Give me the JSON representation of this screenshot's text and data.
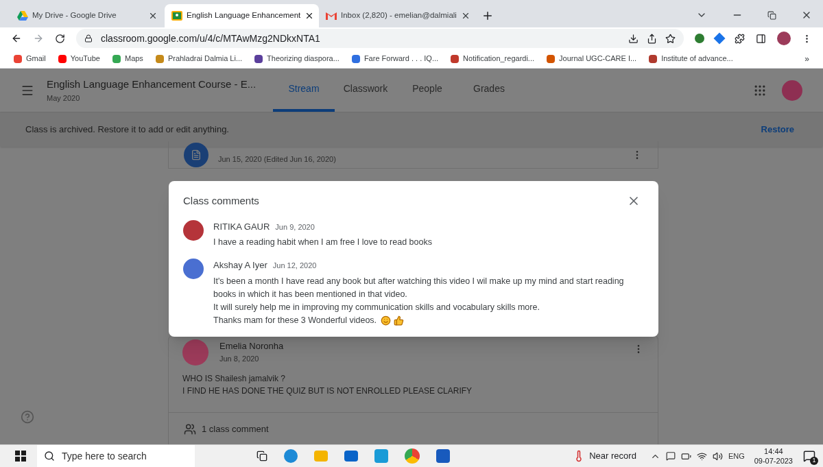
{
  "browser": {
    "tabs": [
      {
        "title": "My Drive - Google Drive",
        "kind": "drive",
        "selected": false
      },
      {
        "title": "English Language Enhancement",
        "kind": "classroom",
        "selected": true
      },
      {
        "title": "Inbox (2,820) - emelian@dalmiali",
        "kind": "gmail",
        "selected": false
      }
    ],
    "address": "classroom.google.com/u/4/c/MTAwMzg2NDkxNTA1",
    "bookmarks": [
      {
        "label": "Gmail",
        "color": "#ea4335"
      },
      {
        "label": "YouTube",
        "color": "#ff0000"
      },
      {
        "label": "Maps",
        "color": "#34a853"
      },
      {
        "label": "Prahladrai Dalmia Li...",
        "color": "#c58a1a"
      },
      {
        "label": "Theorizing diaspora...",
        "color": "#5b3f9c"
      },
      {
        "label": "Fare Forward . . . IQ...",
        "color": "#2f6fe0"
      },
      {
        "label": "Notification_regardi...",
        "color": "#c0392b"
      },
      {
        "label": "Journal UGC-CARE I...",
        "color": "#d35400"
      },
      {
        "label": "Institute of advance...",
        "color": "#b03a2e"
      }
    ],
    "more_bookmarks": "»"
  },
  "classroom": {
    "title": "English Language Enhancement Course - E...",
    "subtitle": "May 2020",
    "tabs": [
      {
        "label": "Stream",
        "selected": true
      },
      {
        "label": "Classwork",
        "selected": false
      },
      {
        "label": "People",
        "selected": false
      },
      {
        "label": "Grades",
        "selected": false
      }
    ],
    "banner": {
      "text": "Class is archived. Restore it to add or edit anything.",
      "action": "Restore"
    },
    "post": {
      "date": "Jun 15, 2020 (Edited Jun 16, 2020)"
    },
    "announcement": {
      "author": "Emelia Noronha",
      "date": "Jun 8, 2020",
      "lines": [
        "WHO IS Shailesh jamalvik ?",
        "I FIND HE HAS DONE THE QUIZ BUT IS NOT ENROLLED PLEASE CLARIFY"
      ],
      "comment_count": "1 class comment"
    }
  },
  "dialog": {
    "title": "Class comments",
    "comments": [
      {
        "author": "RITIKA GAUR",
        "date": "Jun 9, 2020",
        "lines": [
          "I have a reading habit when I am free I love to read books"
        ]
      },
      {
        "author": "Akshay A Iyer",
        "date": "Jun 12, 2020",
        "lines": [
          "It's been a month I have read any book but after watching this video I wil make up my mind and start reading books in which it has been mentioned in that video.",
          "It will surely help me in improving my communication skills and vocabulary skills more.",
          "Thanks mam for these 3 Wonderful videos."
        ]
      }
    ]
  },
  "taskbar": {
    "search_placeholder": "Type here to search",
    "weather": "Near record",
    "language": "ENG",
    "time": "14:44",
    "date": "09-07-2023",
    "notifications": "1"
  }
}
